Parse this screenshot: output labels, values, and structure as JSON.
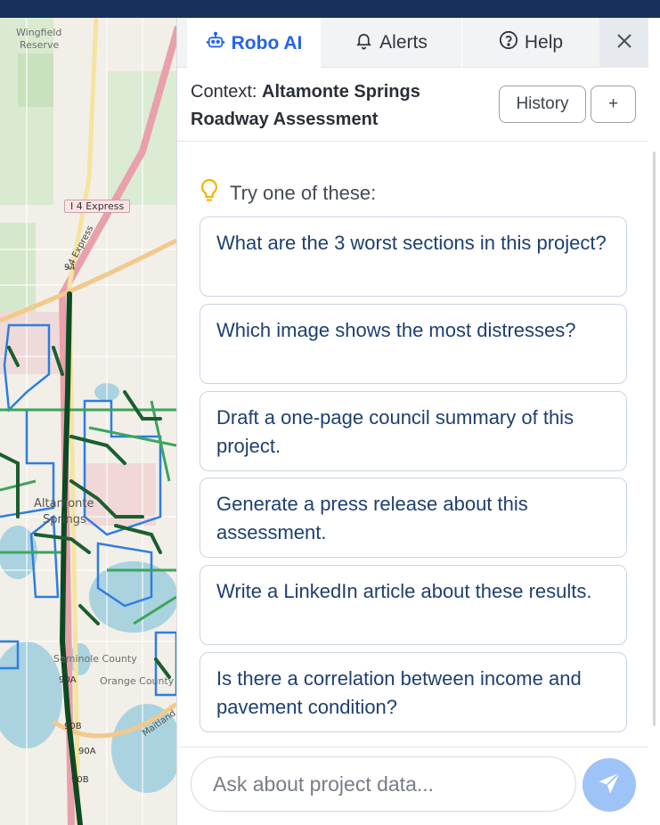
{
  "map": {
    "labels": {
      "wingfield": "Wingfield",
      "reserve": "Reserve",
      "i4_express": "I 4 Express",
      "i4_express_diag": "I 4 Express",
      "road_94": "94",
      "altamonte_1": "Altamonte",
      "altamonte_2": "Springs",
      "seminole_county": "Seminole County",
      "orange_county": "Orange County",
      "road_90a": "90A",
      "road_90b_top": "90B",
      "road_90a_low": "90A",
      "road_90b": "90B",
      "maitland": "Maitland"
    }
  },
  "tabs": [
    {
      "label": "Robo AI",
      "icon": "robot-icon",
      "active": true
    },
    {
      "label": "Alerts",
      "icon": "bell-icon",
      "active": false
    },
    {
      "label": "Help",
      "icon": "help-circle-icon",
      "active": false
    }
  ],
  "header": {
    "context_prefix": "Context:",
    "context_name": "Altamonte Springs Roadway Assessment",
    "history_label": "History",
    "new_label": "+"
  },
  "suggestions": {
    "heading": "Try one of these:",
    "items": [
      "What are the 3 worst sections in this project?",
      "Which image shows the most distresses?",
      "Draft a one-page council summary of this project.",
      "Generate a press release about this assessment.",
      "Write a LinkedIn article about these results.",
      "Is there a correlation between income and pavement condition?"
    ]
  },
  "composer": {
    "placeholder": "Ask about project data...",
    "send_icon": "send-icon"
  },
  "colors": {
    "accent": "#2563eb",
    "suggestion_text": "#1e3f70",
    "send_button": "#9ec3f7",
    "top_bar": "#17305c",
    "hint_bulb": "#f5b301"
  }
}
